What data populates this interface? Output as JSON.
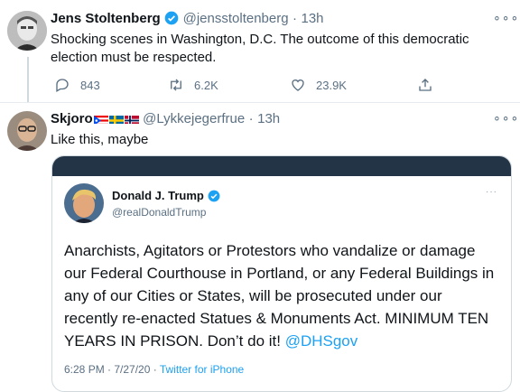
{
  "tweet1": {
    "name": "Jens Stoltenberg",
    "handle": "@jensstoltenberg",
    "sep": "·",
    "time": "13h",
    "text": "Shocking scenes in Washington, D.C. The outcome of this democratic election must be respected.",
    "replies": "843",
    "retweets": "6.2K",
    "likes": "23.9K"
  },
  "tweet2": {
    "name": "Skjoro",
    "handle": "@Lykkejegerfrue",
    "sep": "·",
    "time": "13h",
    "text": "Like this, maybe",
    "flags": [
      "puerto-rico-flag",
      "sweden-flag",
      "norway-flag"
    ]
  },
  "embedded": {
    "name": "Donald J. Trump",
    "handle": "@realDonaldTrump",
    "text_plain": "Anarchists, Agitators or Protestors who vandalize or damage our Federal Courthouse in Portland, or any Federal Buildings in any of our Cities or States, will be prosecuted under our recently re-enacted Statues & Monuments Act. MINIMUM TEN YEARS IN PRISON. Don’t do it!",
    "mention": "@DHSgov",
    "timestamp": "6:28 PM · 7/27/20 ·",
    "source": "Twitter for iPhone"
  },
  "colors": {
    "link": "#1da1f2",
    "verified": "#1da1f2",
    "muted": "#5b7083",
    "embed_header": "#243447"
  },
  "icons": [
    "more-icon",
    "reply-icon",
    "retweet-icon",
    "like-icon",
    "share-icon",
    "verified-icon"
  ]
}
